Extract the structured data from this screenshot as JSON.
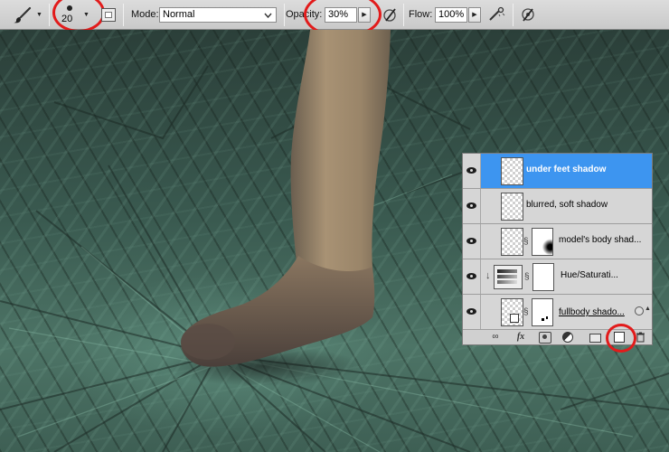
{
  "options_bar": {
    "brush_size": "20",
    "mode_label": "Mode:",
    "mode_value": "Normal",
    "opacity_label": "Opacity:",
    "opacity_value": "30%",
    "flow_label": "Flow:",
    "flow_value": "100%"
  },
  "layers": [
    {
      "name": "under feet shadow",
      "selected": true
    },
    {
      "name": "blurred, soft shadow",
      "selected": false
    },
    {
      "name": "model's body shad...",
      "selected": false
    },
    {
      "name": "Hue/Saturati...",
      "selected": false
    },
    {
      "name": "fullbody shado...",
      "selected": false
    }
  ],
  "layer_footer_icons": [
    "link-icon",
    "fx-icon",
    "add-mask-icon",
    "adjustment-layer-icon",
    "new-group-icon",
    "new-layer-icon",
    "trash-icon"
  ],
  "colors": {
    "selection_blue": "#3d95f0",
    "highlight_red": "#e21b1b",
    "floor_green": "#4d7466"
  }
}
